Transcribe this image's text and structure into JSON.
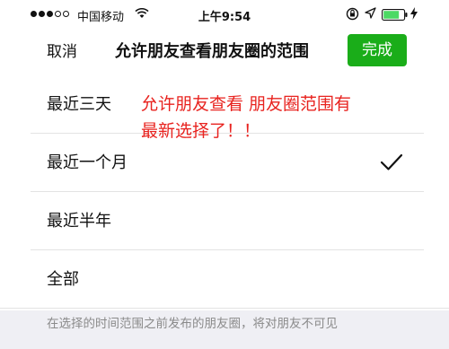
{
  "status_bar": {
    "carrier": "中国移动",
    "time": "上午9:54",
    "signal_strength": 3,
    "signal_max": 5,
    "icons": [
      "wifi-icon",
      "rotation-lock-icon",
      "location-icon",
      "battery-icon",
      "charging-icon"
    ]
  },
  "nav": {
    "cancel_label": "取消",
    "title": "允许朋友查看朋友圈的范围",
    "done_label": "完成",
    "accent_color": "#1aad19"
  },
  "options": [
    {
      "label": "最近三天",
      "selected": false
    },
    {
      "label": "最近一个月",
      "selected": true
    },
    {
      "label": "最近半年",
      "selected": false
    },
    {
      "label": "全部",
      "selected": false
    }
  ],
  "annotation": {
    "line1": "允许朋友查看  朋友圈范围有",
    "line2": "最新选择了！！",
    "color": "#e8231f"
  },
  "footer": {
    "note": "在选择的时间范围之前发布的朋友圈，将对朋友不可见"
  }
}
